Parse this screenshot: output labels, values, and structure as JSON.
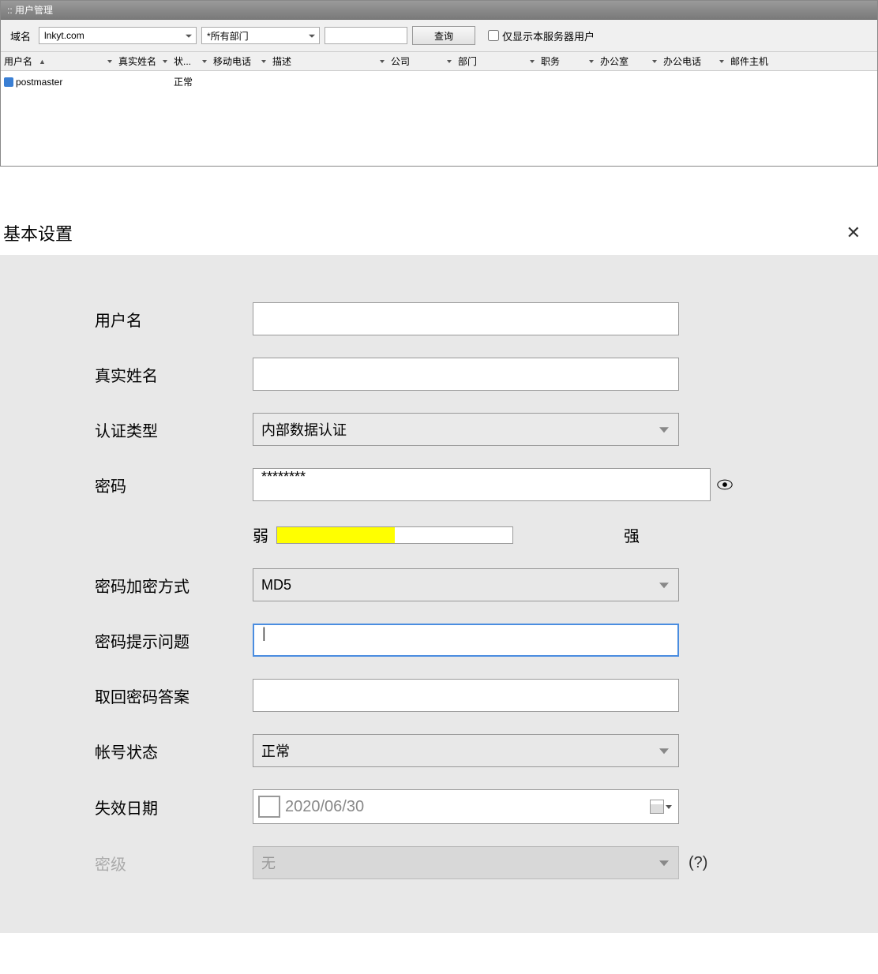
{
  "window": {
    "title": ":: 用户管理"
  },
  "toolbar": {
    "domain_label": "域名",
    "domain_value": "lnkyt.com",
    "dept_value": "*所有部门",
    "query_btn": "查询",
    "server_only_label": "仅显示本服务器用户"
  },
  "grid": {
    "columns": [
      "用户名",
      "真实姓名",
      "状...",
      "移动电话",
      "描述",
      "公司",
      "部门",
      "职务",
      "办公室",
      "办公电话",
      "邮件主机"
    ],
    "rows": [
      {
        "username": "postmaster",
        "status": "正常"
      }
    ]
  },
  "form": {
    "title": "基本设置",
    "labels": {
      "username": "用户名",
      "realname": "真实姓名",
      "authtype": "认证类型",
      "password": "密码",
      "weak": "弱",
      "strong": "强",
      "encryption": "密码加密方式",
      "hint_question": "密码提示问题",
      "answer": "取回密码答案",
      "account_status": "帐号状态",
      "expire_date": "失效日期",
      "secret_level": "密级"
    },
    "values": {
      "username": "",
      "realname": "",
      "authtype": "内部数据认证",
      "password": "********",
      "encryption": "MD5",
      "hint_question": "",
      "answer": "",
      "account_status": "正常",
      "expire_date": "2020/06/30",
      "secret_level": "无",
      "help": "(?)"
    }
  }
}
